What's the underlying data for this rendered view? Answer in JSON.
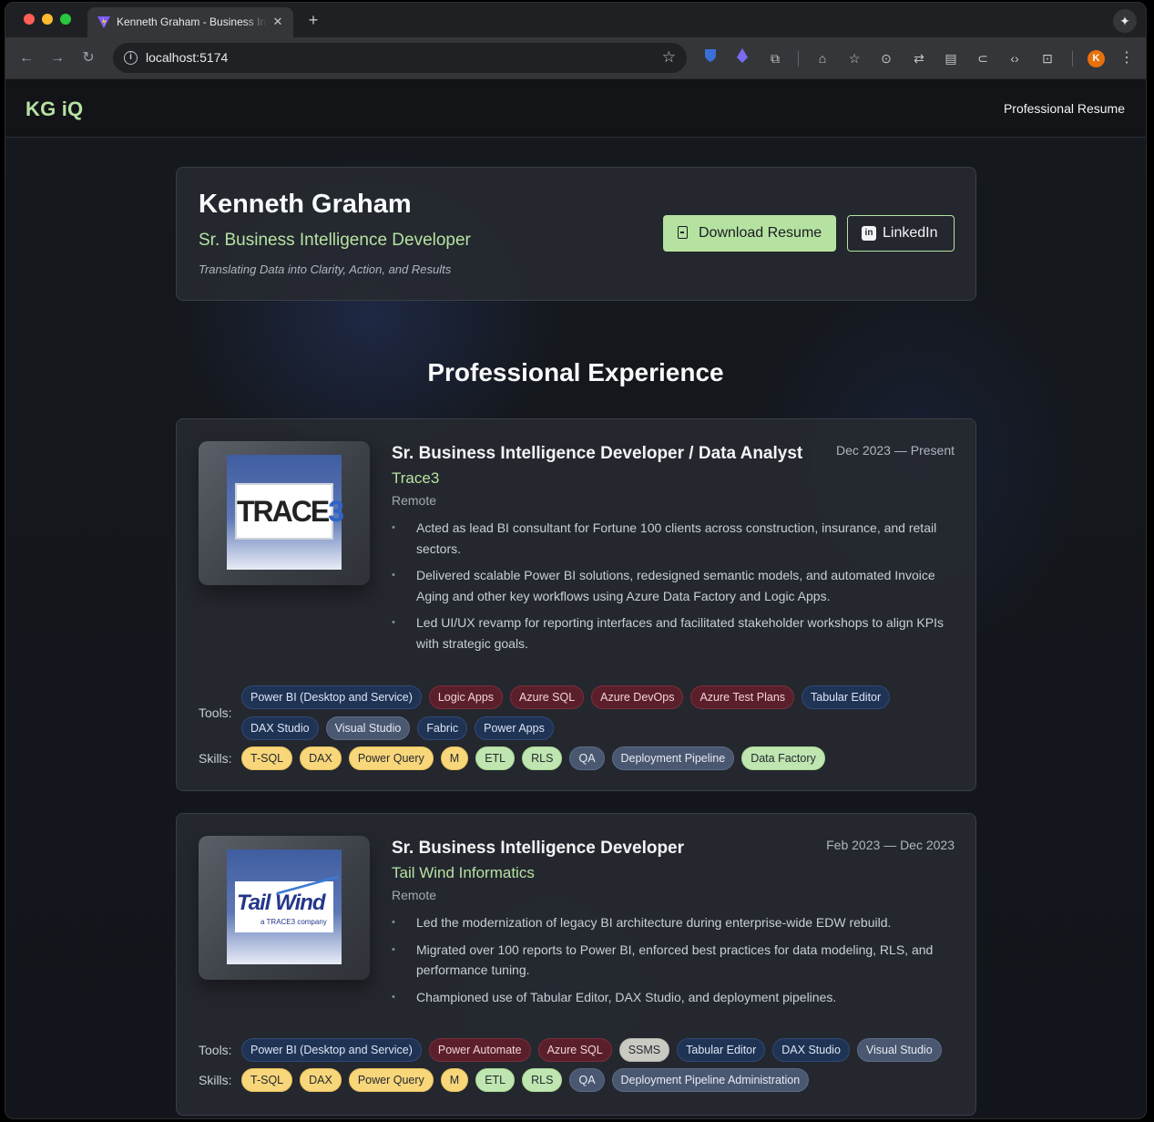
{
  "browser": {
    "tab_title": "Kenneth Graham - Business Intelligence Developer",
    "new_tab": "+",
    "close": "✕",
    "url": "localhost:5174",
    "profile_initial": "K"
  },
  "site": {
    "logo": "KG iQ",
    "nav_link": "Professional Resume"
  },
  "hero": {
    "name": "Kenneth Graham",
    "title": "Sr. Business Intelligence Developer",
    "tagline": "Translating Data into Clarity, Action, and Results",
    "download_label": "Download Resume",
    "linkedin_label": "LinkedIn"
  },
  "experience": {
    "section_title": "Professional Experience",
    "tools_label": "Tools:",
    "skills_label": "Skills:",
    "jobs": [
      {
        "title": "Sr. Business Intelligence Developer / Data Analyst",
        "dates": "Dec 2023 — Present",
        "company": "Trace3",
        "location": "Remote",
        "logo_text": "TRACE",
        "logo_accent": "3",
        "bullets": [
          "Acted as lead BI consultant for Fortune 100 clients across construction, insurance, and retail sectors.",
          "Delivered scalable Power BI solutions, redesigned semantic models, and automated Invoice Aging and other key workflows using Azure Data Factory and Logic Apps.",
          "Led UI/UX revamp for reporting interfaces and facilitated stakeholder workshops to align KPIs with strategic goals."
        ],
        "tools": [
          {
            "label": "Power BI (Desktop and Service)",
            "color": "blue"
          },
          {
            "label": "Logic Apps",
            "color": "red"
          },
          {
            "label": "Azure SQL",
            "color": "red"
          },
          {
            "label": "Azure DevOps",
            "color": "red"
          },
          {
            "label": "Azure Test Plans",
            "color": "red"
          },
          {
            "label": "Tabular Editor",
            "color": "blue"
          },
          {
            "label": "DAX Studio",
            "color": "blue"
          },
          {
            "label": "Visual Studio",
            "color": "slate"
          },
          {
            "label": "Fabric",
            "color": "blue"
          },
          {
            "label": "Power Apps",
            "color": "blue"
          }
        ],
        "skills": [
          {
            "label": "T-SQL",
            "color": "yellow"
          },
          {
            "label": "DAX",
            "color": "yellow"
          },
          {
            "label": "Power Query",
            "color": "yellow"
          },
          {
            "label": "M",
            "color": "yellow"
          },
          {
            "label": "ETL",
            "color": "green"
          },
          {
            "label": "RLS",
            "color": "green"
          },
          {
            "label": "QA",
            "color": "slate"
          },
          {
            "label": "Deployment Pipeline",
            "color": "slate"
          },
          {
            "label": "Data Factory",
            "color": "green"
          }
        ]
      },
      {
        "title": "Sr. Business Intelligence Developer",
        "dates": "Feb 2023 — Dec 2023",
        "company": "Tail Wind Informatics",
        "location": "Remote",
        "logo_text": "Tail Wind",
        "logo_sub": "a TRACE3 company",
        "bullets": [
          "Led the modernization of legacy BI architecture during enterprise-wide EDW rebuild.",
          "Migrated over 100 reports to Power BI, enforced best practices for data modeling, RLS, and performance tuning.",
          "Championed use of Tabular Editor, DAX Studio, and deployment pipelines."
        ],
        "tools": [
          {
            "label": "Power BI (Desktop and Service)",
            "color": "blue"
          },
          {
            "label": "Power Automate",
            "color": "red"
          },
          {
            "label": "Azure SQL",
            "color": "red"
          },
          {
            "label": "SSMS",
            "color": "gray"
          },
          {
            "label": "Tabular Editor",
            "color": "blue"
          },
          {
            "label": "DAX Studio",
            "color": "blue"
          },
          {
            "label": "Visual Studio",
            "color": "slate"
          }
        ],
        "skills": [
          {
            "label": "T-SQL",
            "color": "yellow"
          },
          {
            "label": "DAX",
            "color": "yellow"
          },
          {
            "label": "Power Query",
            "color": "yellow"
          },
          {
            "label": "M",
            "color": "yellow"
          },
          {
            "label": "ETL",
            "color": "green"
          },
          {
            "label": "RLS",
            "color": "green"
          },
          {
            "label": "QA",
            "color": "slate"
          },
          {
            "label": "Deployment Pipeline Administration",
            "color": "slate"
          }
        ]
      }
    ]
  },
  "colors": {
    "accent": "#b6e2a1",
    "background": "#14171c",
    "card": "#262930"
  }
}
